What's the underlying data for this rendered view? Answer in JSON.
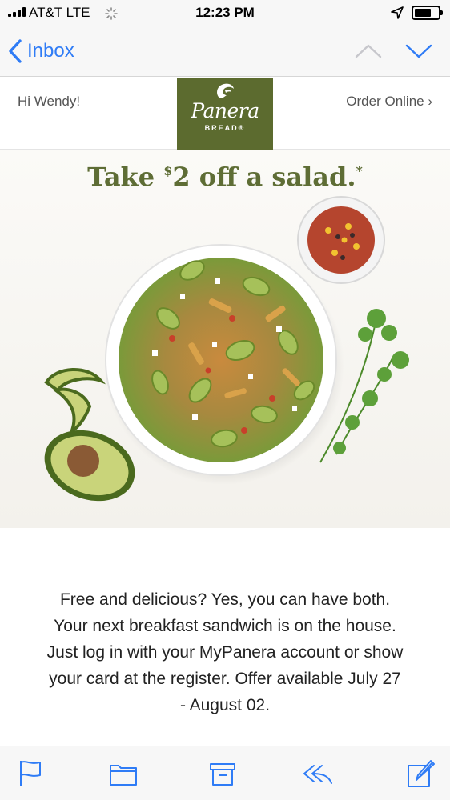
{
  "status_bar": {
    "carrier": "AT&T  LTE",
    "time": "12:23 PM",
    "icons": [
      "signal-bars-icon",
      "loading-spinner-icon",
      "location-arrow-icon",
      "battery-icon"
    ]
  },
  "nav": {
    "back_label": "Inbox",
    "icons": [
      "chevron-left-icon",
      "chevron-up-icon",
      "chevron-down-icon"
    ]
  },
  "email": {
    "greeting": "Hi Wendy!",
    "order_link": "Order Online ›",
    "logo": {
      "brand": "Panera",
      "sub": "BREAD®"
    },
    "headline": {
      "pre": "Take ",
      "currency": "$",
      "amount": "2 off a salad.",
      "asterisk": "*"
    },
    "body_lines": [
      "Free and delicious? Yes, you can have both.",
      "Your next breakfast sandwich is on the house.",
      "Just log in with your MyPanera account or show",
      "your card at the register. Offer available July 27",
      "- August 02."
    ]
  },
  "toolbar": {
    "icons": [
      "flag-icon",
      "folder-icon",
      "archive-icon",
      "reply-icon",
      "compose-icon"
    ]
  },
  "colors": {
    "ios_blue": "#2f7cf6",
    "panera_green": "#5c6b2f",
    "headline_green": "#5e6d35"
  }
}
